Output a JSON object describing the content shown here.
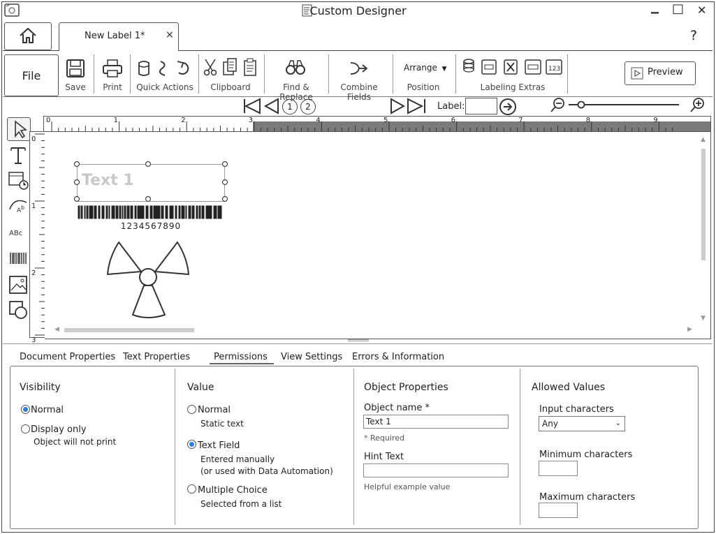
{
  "window": {
    "title": "Custom Designer",
    "minimize": "▁",
    "maximize": "□",
    "close": "✕"
  },
  "tabs": {
    "home_icon": "home-icon",
    "document_tab": "New Label 1*",
    "tab_close": "×",
    "help": "?"
  },
  "ribbon": {
    "file": "File",
    "save": "Save",
    "print": "Print",
    "quick_actions": "Quick Actions",
    "clipboard": "Clipboard",
    "find_replace": "Find & Replace",
    "combine_fields": "Combine Fields",
    "arrange": "Arrange",
    "position": "Position",
    "labeling_extras": "Labeling Extras",
    "preview": "Preview"
  },
  "navigation": {
    "page1": "1",
    "page2": "2",
    "label_text": "Label:",
    "label_value": ""
  },
  "ruler": {
    "h_ticks": [
      "0",
      "1",
      "2",
      "3",
      "4",
      "5",
      "6",
      "7",
      "8",
      "9"
    ],
    "v_ticks": [
      "0",
      "1",
      "2",
      "3"
    ]
  },
  "canvas": {
    "text_object": "Text 1",
    "barcode_value": "1234567890"
  },
  "bottom_tabs": [
    "Document Properties",
    "Text Properties",
    "Permissions",
    "View Settings",
    "Errors & Information"
  ],
  "visibility": {
    "title": "Visibility",
    "normal": "Normal",
    "display_only": "Display only",
    "display_only_sub": "Object will not print"
  },
  "value": {
    "title": "Value",
    "normal": "Normal",
    "normal_sub": "Static text",
    "text_field": "Text Field",
    "text_field_sub1": "Entered manually",
    "text_field_sub2": "(or used with Data Automation)",
    "multiple_choice": "Multiple Choice",
    "multiple_choice_sub": "Selected from a list"
  },
  "object_properties": {
    "title": "Object Properties",
    "object_name_label": "Object name *",
    "object_name_value": "Text 1",
    "required": "* Required",
    "hint_label": "Hint Text",
    "hint_value": "",
    "hint_help": "Helpful example value"
  },
  "allowed_values": {
    "title": "Allowed Values",
    "input_chars_label": "Input characters",
    "input_chars_value": "Any",
    "min_label": "Minimum characters",
    "min_value": "",
    "max_label": "Maximum characters",
    "max_value": ""
  }
}
